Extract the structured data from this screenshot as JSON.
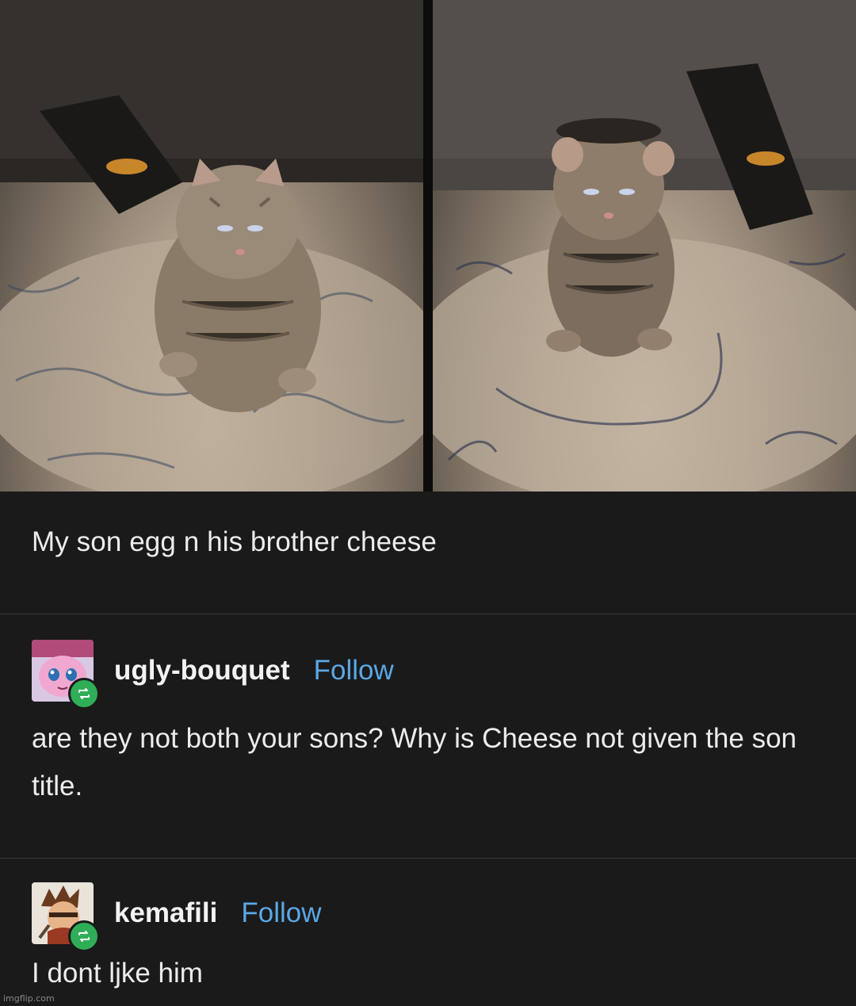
{
  "post": {
    "photos": [
      {
        "subject": "kitten-egg"
      },
      {
        "subject": "kitten-cheese"
      }
    ],
    "caption": "My son egg n his brother cheese"
  },
  "replies": [
    {
      "username": "ugly-bouquet",
      "follow_label": "Follow",
      "text": "are they not both your sons? Why is Cheese not given the son title.",
      "avatar_icon": "pink-jigglypuff-avatar",
      "badge_icon": "reblog-icon"
    },
    {
      "username": "kemafili",
      "follow_label": "Follow",
      "text": "I dont ljke him",
      "avatar_icon": "anime-character-avatar",
      "badge_icon": "reblog-icon"
    }
  ],
  "colors": {
    "background": "#1a1a1a",
    "follow_link": "#5aa8e6",
    "reblog_badge": "#2fae57",
    "divider": "#3a3a3a"
  },
  "watermark": "imgflip.com"
}
